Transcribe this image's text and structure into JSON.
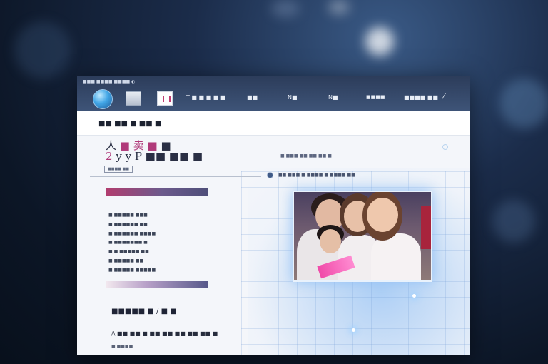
{
  "window": {
    "top_small_text": "■■■ ■■■■ ■■■■  ◐",
    "nav": [
      "T ■ ■ ■ ■ ■",
      "■■",
      "N■",
      "N■",
      "■■■■",
      "■■■■ ■■"
    ],
    "close_symbol": "⁄"
  },
  "subbar": {
    "title": "■■ ■■ ■ ■■ ■"
  },
  "hero": {
    "line1_prefix": "人",
    "line1_accent": "■ 卖 ■",
    "line1_suffix": "■",
    "line2_accent": "2",
    "line2_rest": "y y P ■■ ■■ ■",
    "tag": "■■■■ ■■"
  },
  "right_panel": {
    "meta_text": "■ ■■■ ■■ ■■ ■■ ■",
    "meta_text2": "■■ ■■■ ■ ■■■■ ■ ■■■■ ■■"
  },
  "list_items": [
    "■ ■■■■■ ■■■",
    "■ ■■■■■■ ■■",
    "■ ■■■■■■ ■■■■",
    "■ ■■■■■■■ ■",
    "■ ■ ■■■■■ ■■",
    "■ ■■■■■ ■■",
    "■ ■■■■■ ■■■■■"
  ],
  "section": {
    "heading": "■■■■■ ■ /  ■ ■",
    "body": "/\\ ■■ ■■ ■ ■■ ■■ ■■ ■■ ■■ ■",
    "foot": "■ ■■■■"
  },
  "colors": {
    "accent_pink": "#b03a7a",
    "nav_background": "#2c3c5a",
    "glow_blue": "#aacdf5"
  }
}
